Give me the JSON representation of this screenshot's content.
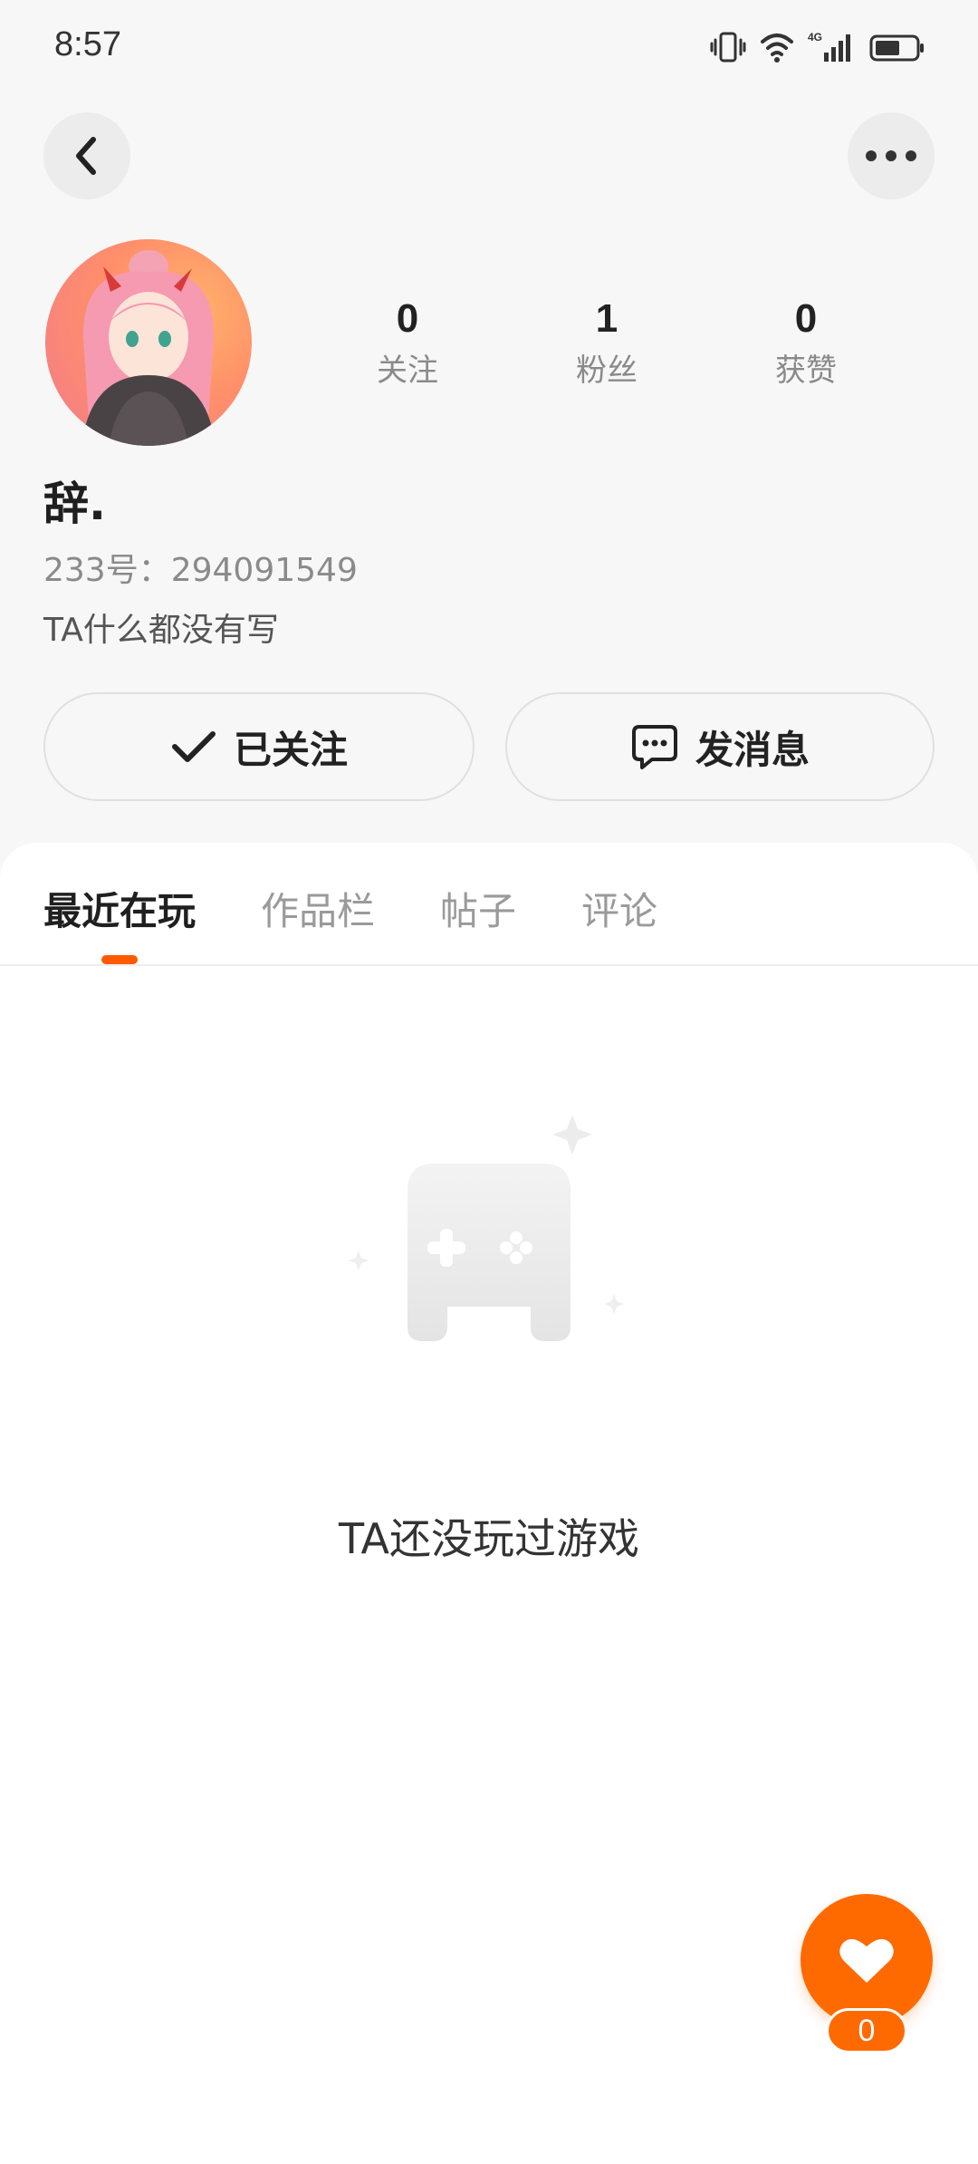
{
  "status_bar": {
    "time": "8:57",
    "network": "4G",
    "icons": [
      "vibrate-icon",
      "wifi-icon",
      "signal-icon",
      "battery-icon"
    ]
  },
  "nav": {
    "back_icon": "chevron-left-icon",
    "more_icon": "more-horizontal-icon"
  },
  "profile": {
    "username": "辞.",
    "uid": "233号：294091549",
    "bio": "TA什么都没有写",
    "stats": [
      {
        "value": "0",
        "label": "关注"
      },
      {
        "value": "1",
        "label": "粉丝"
      },
      {
        "value": "0",
        "label": "获赞"
      }
    ]
  },
  "actions": {
    "follow_label": "已关注",
    "message_label": "发消息"
  },
  "tabs": [
    {
      "label": "最近在玩",
      "active": true
    },
    {
      "label": "作品栏",
      "active": false
    },
    {
      "label": "帖子",
      "active": false
    },
    {
      "label": "评论",
      "active": false
    }
  ],
  "empty_state": {
    "text": "TA还没玩过游戏",
    "icon": "gamepad-icon"
  },
  "like": {
    "icon": "heart-icon",
    "count": "0"
  },
  "colors": {
    "accent": "#ff6a00",
    "tab_indicator": "#ff5a00",
    "background": "#f7f7f7"
  }
}
